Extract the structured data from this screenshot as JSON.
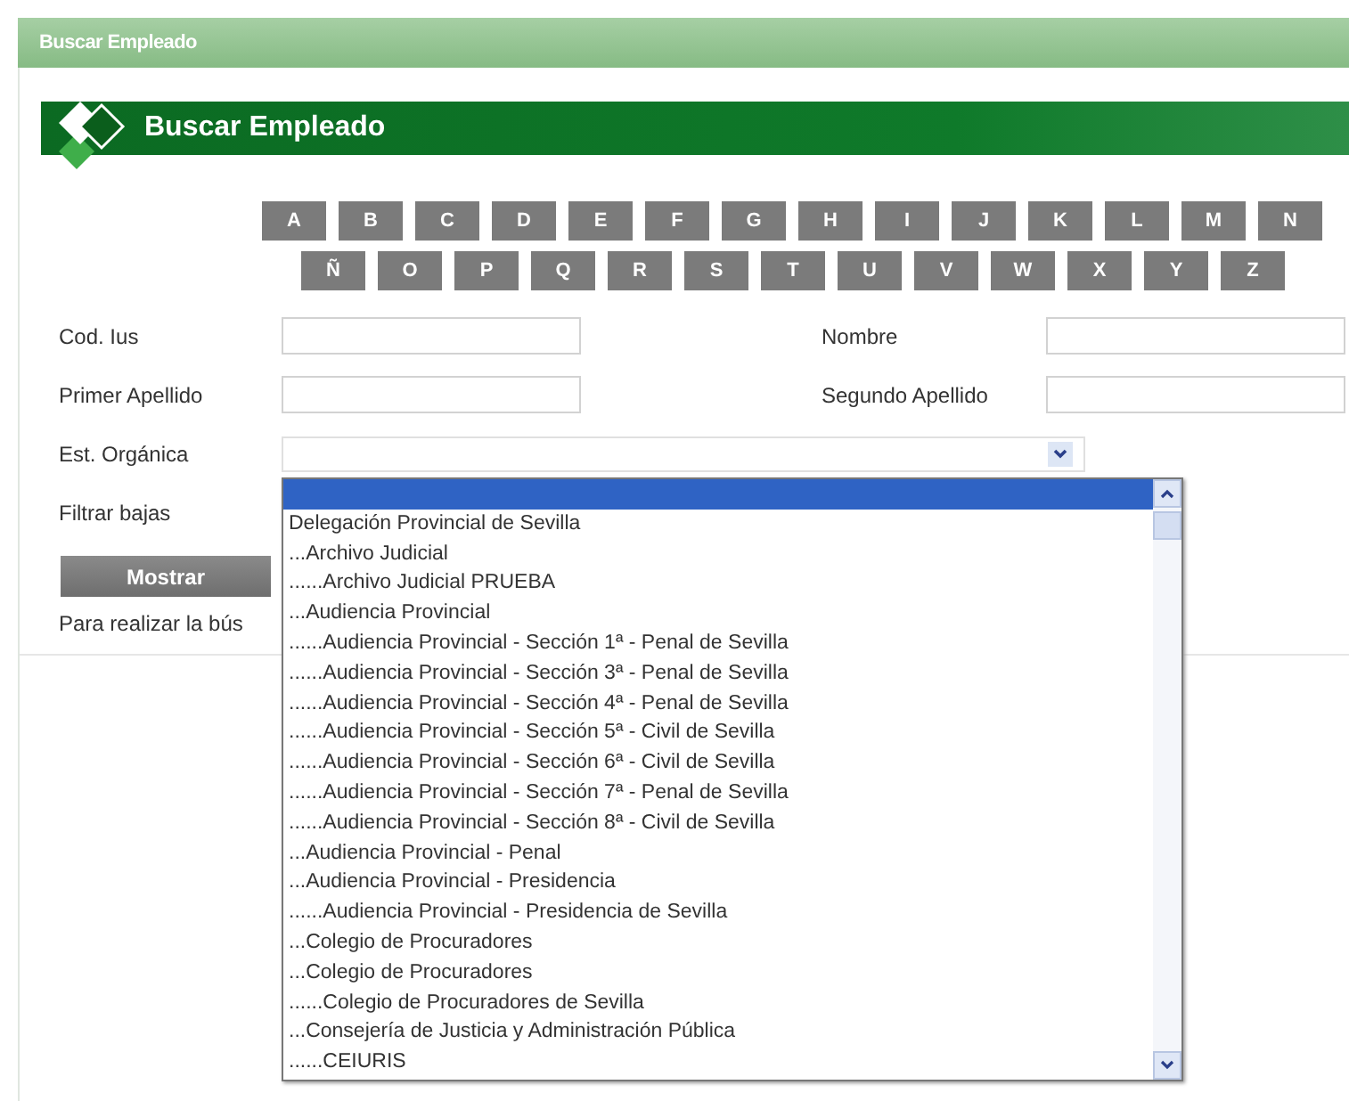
{
  "window": {
    "title": "Buscar Empleado"
  },
  "banner": {
    "title": "Buscar Empleado"
  },
  "letter_rows": [
    [
      "A",
      "B",
      "C",
      "D",
      "E",
      "F",
      "G",
      "H",
      "I",
      "J",
      "K",
      "L",
      "M",
      "N"
    ],
    [
      "Ñ",
      "O",
      "P",
      "Q",
      "R",
      "S",
      "T",
      "U",
      "V",
      "W",
      "X",
      "Y",
      "Z"
    ]
  ],
  "fields": [
    {
      "label": "Cod. Ius",
      "kind": "text"
    },
    {
      "label": "Nombre",
      "kind": "text"
    },
    {
      "label": "Primer Apellido",
      "kind": "text"
    },
    {
      "label": "Segundo Apellido",
      "kind": "text"
    },
    {
      "label": "Est. Orgánica",
      "kind": "select"
    },
    {
      "label": "Filtrar bajas",
      "kind": "none"
    }
  ],
  "button": "Mostrar",
  "hint": "Para realizar la bús",
  "dropdown_options": [
    {
      "selected": true
    },
    {
      "label": "Delegación Provincial de Sevilla",
      "selected": false
    },
    {
      "label": "...Archivo Judicial",
      "selected": false
    },
    {
      "label": "......Archivo Judicial PRUEBA",
      "selected": false
    },
    {
      "label": "...Audiencia Provincial",
      "selected": false
    },
    {
      "label": "......Audiencia Provincial - Sección 1ª - Penal de Sevilla",
      "selected": false
    },
    {
      "label": "......Audiencia Provincial - Sección 3ª - Penal de Sevilla",
      "selected": false
    },
    {
      "label": "......Audiencia Provincial - Sección 4ª - Penal de Sevilla",
      "selected": false
    },
    {
      "label": "......Audiencia Provincial - Sección 5ª - Civil de Sevilla",
      "selected": false
    },
    {
      "label": "......Audiencia Provincial - Sección 6ª - Civil de Sevilla",
      "selected": false
    },
    {
      "label": "......Audiencia Provincial - Sección 7ª - Penal de Sevilla",
      "selected": false
    },
    {
      "label": "......Audiencia Provincial - Sección 8ª - Civil de Sevilla",
      "selected": false
    },
    {
      "label": "...Audiencia Provincial - Penal",
      "selected": false
    },
    {
      "label": "...Audiencia Provincial - Presidencia",
      "selected": false
    },
    {
      "label": "......Audiencia Provincial - Presidencia de Sevilla",
      "selected": false
    },
    {
      "label": "...Colegio de Procuradores",
      "selected": false
    },
    {
      "label": "...Colegio de Procuradores",
      "selected": false
    },
    {
      "label": "......Colegio de Procuradores de Sevilla",
      "selected": false
    },
    {
      "label": "...Consejería de Justicia y Administración Pública",
      "selected": false
    },
    {
      "label": "......CEIURIS",
      "selected": false
    }
  ]
}
